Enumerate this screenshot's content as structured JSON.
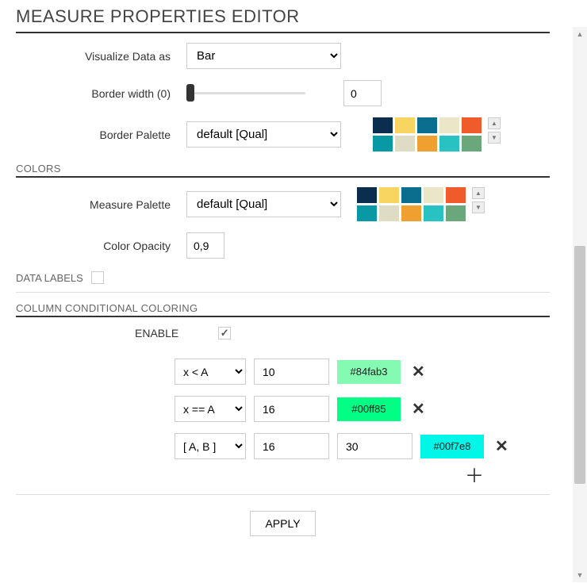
{
  "title": "MEASURE PROPERTIES EDITOR",
  "visualize": {
    "label": "Visualize Data as",
    "value": "Bar"
  },
  "border_width": {
    "label": "Border width (0)",
    "value": "0"
  },
  "border_palette": {
    "label": "Border Palette",
    "value": "default [Qual]",
    "swatches": [
      "#0b2e4f",
      "#f7d560",
      "#0b6e8f",
      "#ece6c9",
      "#f05b2b",
      "#0999a5",
      "#dfdcc5",
      "#f0a030",
      "#28c2c2",
      "#6aa77a"
    ]
  },
  "colors_section": "COLORS",
  "measure_palette": {
    "label": "Measure Palette",
    "value": "default [Qual]",
    "swatches": [
      "#0b2e4f",
      "#f7d560",
      "#0b6e8f",
      "#ece6c9",
      "#f05b2b",
      "#0999a5",
      "#dfdcc5",
      "#f0a030",
      "#28c2c2",
      "#6aa77a"
    ]
  },
  "color_opacity": {
    "label": "Color Opacity",
    "value": "0,9"
  },
  "data_labels": "DATA LABELS",
  "ccc": {
    "section": "COLUMN CONDITIONAL COLORING",
    "enable_label": "ENABLE",
    "enabled": true,
    "rows": [
      {
        "op": "x < A",
        "a": "10",
        "b": null,
        "color": "#84fab3"
      },
      {
        "op": "x == A",
        "a": "16",
        "b": null,
        "color": "#00ff85"
      },
      {
        "op": "[ A, B ]",
        "a": "16",
        "b": "30",
        "color": "#00f7e8"
      }
    ]
  },
  "apply": "APPLY"
}
